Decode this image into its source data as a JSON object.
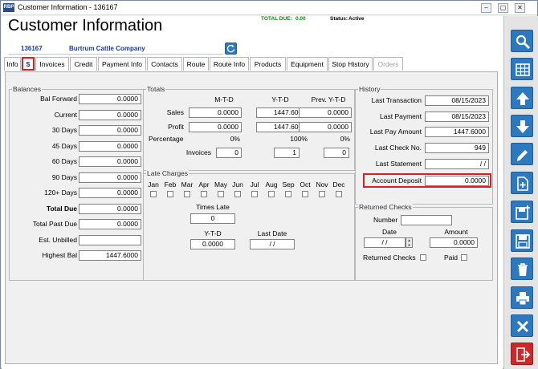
{
  "window": {
    "title": "Customer Information - 136167",
    "app_icon": "RBP"
  },
  "header": {
    "page_title": "Customer Information",
    "total_due_label": "TOTAL DUE:",
    "total_due_value": "0.00",
    "status_label": "Status:",
    "status_value": "Active"
  },
  "customer": {
    "number": "136167",
    "name": "Burtrum Cattle Company"
  },
  "tabs": [
    {
      "label": "Info"
    },
    {
      "label": "$"
    },
    {
      "label": "Invoices"
    },
    {
      "label": "Credit"
    },
    {
      "label": "Payment Info"
    },
    {
      "label": "Contacts"
    },
    {
      "label": "Route"
    },
    {
      "label": "Route Info"
    },
    {
      "label": "Products"
    },
    {
      "label": "Equipment"
    },
    {
      "label": "Stop History"
    },
    {
      "label": "Orders"
    }
  ],
  "balances": {
    "title": "Balances",
    "rows": [
      {
        "label": "Bal Forward",
        "value": "0.0000"
      },
      {
        "label": "Current",
        "value": "0.0000"
      },
      {
        "label": "30 Days",
        "value": "0.0000"
      },
      {
        "label": "45 Days",
        "value": "0.0000"
      },
      {
        "label": "60 Days",
        "value": "0.0000"
      },
      {
        "label": "90 Days",
        "value": "0.0000"
      },
      {
        "label": "120+ Days",
        "value": "0.0000"
      },
      {
        "label": "Total Due",
        "value": "0.0000"
      },
      {
        "label": "Total Past Due",
        "value": "0.0000"
      },
      {
        "label": "Est. Unbilled",
        "value": ""
      },
      {
        "label": "Highest Bal",
        "value": "1447.6000"
      }
    ]
  },
  "totals": {
    "title": "Totals",
    "col_mtd": "M-T-D",
    "col_ytd": "Y-T-D",
    "col_prev": "Prev. Y-T-D",
    "sales_label": "Sales",
    "sales": [
      "0.0000",
      "1447.6000",
      "0.0000"
    ],
    "profit_label": "Profit",
    "profit": [
      "0.0000",
      "1447.6000",
      "0.0000"
    ],
    "percentage_label": "Percentage",
    "percentage": [
      "0%",
      "100%",
      "0%"
    ],
    "invoices_label": "Invoices",
    "invoices": [
      "0",
      "1",
      "0"
    ]
  },
  "late_charges": {
    "title": "Late Charges",
    "months": [
      "Jan",
      "Feb",
      "Mar",
      "Apr",
      "May",
      "Jun",
      "Jul",
      "Aug",
      "Sep",
      "Oct",
      "Nov",
      "Dec"
    ],
    "times_late_label": "Times Late",
    "times_late": "0",
    "ytd_label": "Y-T-D",
    "ytd": "0.0000",
    "last_date_label": "Last Date",
    "last_date": "/ /"
  },
  "history": {
    "title": "History",
    "last_transaction_label": "Last Transaction",
    "last_transaction": "08/15/2023",
    "last_payment_label": "Last Payment",
    "last_payment": "08/15/2023",
    "last_pay_amount_label": "Last Pay Amount",
    "last_pay_amount": "1447.6000",
    "last_check_label": "Last Check No.",
    "last_check": "949",
    "last_statement_label": "Last Statement",
    "last_statement": "/ /",
    "account_deposit_label": "Account Deposit",
    "account_deposit": "0.0000"
  },
  "returned_checks": {
    "title": "Returned Checks",
    "number_label": "Number",
    "number": "",
    "date_label": "Date",
    "date": "/ /",
    "amount_label": "Amount",
    "amount": "0.0000",
    "returned_label": "Returned Checks",
    "paid_label": "Paid"
  },
  "sidebar": [
    "search-icon",
    "grid-icon",
    "arrow-up-icon",
    "arrow-down-icon",
    "pencil-icon",
    "new-document-icon",
    "add-save-icon",
    "save-icon",
    "trash-icon",
    "print-icon",
    "close-icon",
    "exit-icon"
  ]
}
